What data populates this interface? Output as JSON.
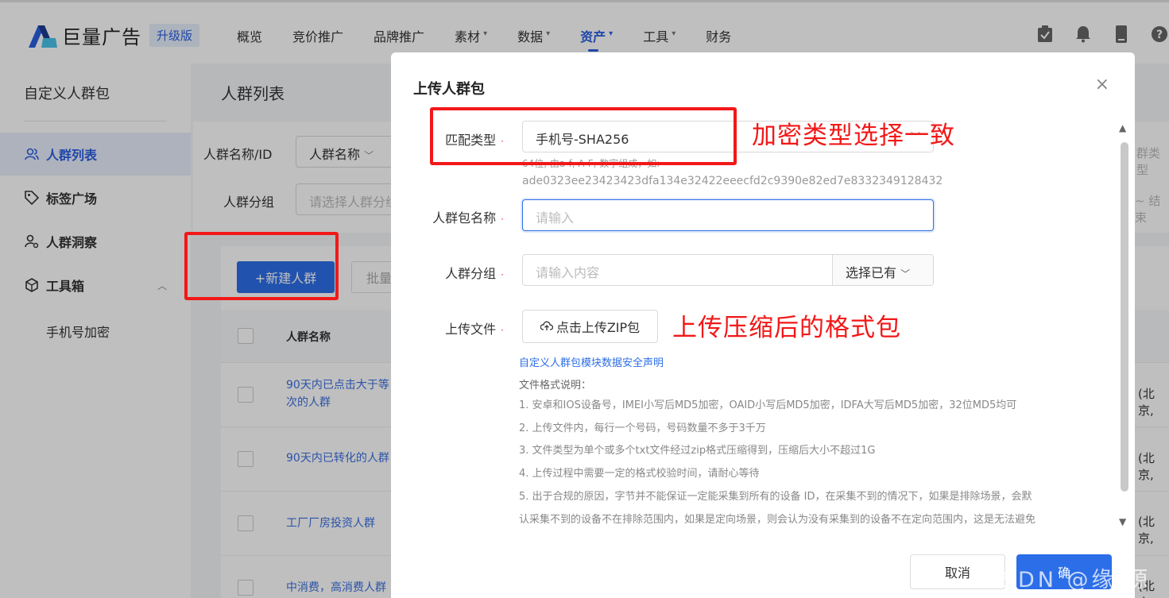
{
  "brand": {
    "name": "巨量广告",
    "badge": "升级版"
  },
  "nav": [
    {
      "label": "概览",
      "caret": ""
    },
    {
      "label": "竞价推广",
      "caret": ""
    },
    {
      "label": "品牌推广",
      "caret": ""
    },
    {
      "label": "素材",
      "caret": "▾"
    },
    {
      "label": "数据",
      "caret": "▾"
    },
    {
      "label": "资产",
      "caret": "▾",
      "active": true
    },
    {
      "label": "工具",
      "caret": "▾"
    },
    {
      "label": "财务",
      "caret": ""
    }
  ],
  "sidebar": {
    "title": "自定义人群包",
    "items": [
      {
        "label": "人群列表",
        "icon": "users-icon"
      },
      {
        "label": "标签广场",
        "icon": "tag-icon"
      },
      {
        "label": "人群洞察",
        "icon": "user-search-icon"
      },
      {
        "label": "工具箱",
        "icon": "cube-icon"
      }
    ],
    "sub_item": "手机号加密"
  },
  "main": {
    "title": "人群列表",
    "filters": {
      "name_label": "人群名称/ID",
      "name_select": "人群名称",
      "group_label": "人群分组",
      "group_placeholder": "请选择人群分组"
    },
    "right_cut": {
      "type": "群类型",
      "date": "~ 结束"
    },
    "new_button": "+新建人群",
    "batch_button": "批量",
    "table_header": "人群名称",
    "rows": [
      {
        "name_line1": "90天内已点击大于等",
        "name_line2": "次的人群",
        "right": "(北京,"
      },
      {
        "name_line1": "90天内已转化的人群",
        "name_line2": "",
        "right": "(北京,"
      },
      {
        "name_line1": "工厂厂房投资人群",
        "name_line2": "",
        "right": "(北京,"
      },
      {
        "name_line1": "中消费，高消费人群",
        "name_line2": "",
        "right": "(北京,"
      }
    ]
  },
  "modal": {
    "title": "上传人群包",
    "close": "×",
    "match_type_label": "匹配类型",
    "match_type_value": "手机号-SHA256",
    "match_hint_line1": "64位, 由a-f, A-F, 数字组成，如:",
    "match_hint_line2": "ade0323ee23423423dfa134e32422eeecfd2c9390e82ed7e8332349128432",
    "name_label": "人群包名称",
    "name_placeholder": "请输入",
    "group_label": "人群分组",
    "group_placeholder": "请输入内容",
    "group_select": "选择已有",
    "file_label": "上传文件",
    "upload_button": "点击上传ZIP包",
    "security_link": "自定义人群包模块数据安全声明",
    "format_title": "文件格式说明：",
    "format_items": [
      "1. 安卓和IOS设备号，IMEI小写后MD5加密，OAID小写后MD5加密，IDFA大写后MD5加密，32位MD5均可",
      "2. 上传文件内，每行一个号码，号码数量不多于3千万",
      "3. 文件类型为单个或多个txt文件经过zip格式压缩得到，压缩后大小不超过1G",
      "4. 上传过程中需要一定的格式校验时间，请耐心等待",
      "5. 出于合规的原因，字节并不能保证一定能采集到所有的设备 ID，在采集不到的情况下，如果是排除场景，会默",
      "认采集不到的设备不在排除范围内，如果是定向场景，则会认为没有采集到的设备不在定向范围内，这是无法避免"
    ],
    "cancel": "取消",
    "ok": "确"
  },
  "annotations": {
    "encrypt_note": "加密类型选择一致",
    "upload_note": "上传压缩后的格式包",
    "box_color": "#f21818"
  },
  "watermark": "CSDN @缘 源 园",
  "colors": {
    "primary": "#2c6ee8",
    "nav_active": "#2c5fe2",
    "annotation_red": "#f21818"
  }
}
